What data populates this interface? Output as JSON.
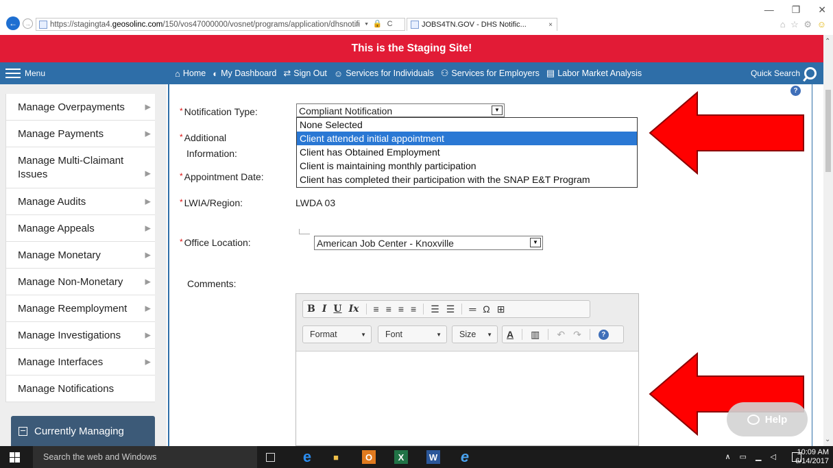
{
  "browser": {
    "url_prefix": "https://stagingta4.",
    "url_domain": "geosolinc.com",
    "url_rest": "/150/vos47000000/vosnet/programs/application/dhsnotifi",
    "url_tools": "⌕ ▾ 🔒 C",
    "tab_title": "JOBS4TN.GOV - DHS Notific...",
    "tab_close": "×",
    "window_controls": [
      "—",
      "❐",
      "✕"
    ],
    "toolbar_icons": "⌂ ☆ ⚙"
  },
  "banner": {
    "text": "This is the Staging Site!"
  },
  "nav": {
    "menu_label": "Menu",
    "links": [
      {
        "icon": "⌂",
        "label": "Home"
      },
      {
        "icon": "◐",
        "label": "My Dashboard"
      },
      {
        "icon": "⇄",
        "label": "Sign Out"
      },
      {
        "icon": "☺",
        "label": "Services for Individuals"
      },
      {
        "icon": "⚇",
        "label": "Services for Employers"
      },
      {
        "icon": "▤",
        "label": "Labor Market Analysis"
      }
    ],
    "quick_search": "Quick Search"
  },
  "sidebar": {
    "items": [
      {
        "label": "Manage Overpayments",
        "chevron": true
      },
      {
        "label": "Manage Payments",
        "chevron": true
      },
      {
        "label": "Manage Multi-Claimant Issues",
        "chevron": true
      },
      {
        "label": "Manage Audits",
        "chevron": true
      },
      {
        "label": "Manage Appeals",
        "chevron": true
      },
      {
        "label": "Manage Monetary",
        "chevron": true
      },
      {
        "label": "Manage Non-Monetary",
        "chevron": true
      },
      {
        "label": "Manage Reemployment",
        "chevron": true
      },
      {
        "label": "Manage Investigations",
        "chevron": true
      },
      {
        "label": "Manage Interfaces",
        "chevron": true
      },
      {
        "label": "Manage Notifications",
        "chevron": false
      }
    ],
    "currently_managing": "Currently Managing"
  },
  "form": {
    "required_mark": "*",
    "notification_type_label": "Notification Type:",
    "notification_type_value": "Compliant Notification",
    "additional_info_label_1": "Additional",
    "additional_info_label_2": "Information:",
    "dropdown_options": [
      "None Selected",
      "Client attended initial appointment",
      "Client has Obtained Employment",
      "Client is maintaining monthly participation",
      "Client has completed their participation with the SNAP E&T Program"
    ],
    "dropdown_selected_index": 1,
    "appointment_date_label": "Appointment Date:",
    "lwia_label": "LWIA/Region:",
    "lwia_value": "LWDA 03",
    "office_location_label": "Office Location:",
    "office_location_value": "American Job Center - Knoxville",
    "comments_label": "Comments:",
    "help_glyph": "?"
  },
  "editor": {
    "row1_buttons": [
      "B",
      "I",
      "U",
      "Ix",
      "≡",
      "≡",
      "≡",
      "≡",
      "☰",
      "☰",
      "═",
      "Ω",
      "⊞"
    ],
    "format_label": "Format",
    "font_label": "Font",
    "size_label": "Size",
    "text_color": "A",
    "row2_icons": [
      "▥",
      "↶",
      "↷"
    ],
    "help": "?"
  },
  "help_widget": {
    "label": "Help"
  },
  "taskbar": {
    "search_placeholder": "Search the web and Windows",
    "apps": [
      "e",
      "■",
      "O",
      "X",
      "W",
      "e"
    ],
    "tray_icons": "∧ ▭ ▁ ◁",
    "time": "10:09 AM",
    "date": "6/14/2017"
  },
  "colors": {
    "banner": "#e21b36",
    "nav": "#2e6ea8",
    "arrow": "#ff0000",
    "selected_option": "#2a78d4"
  }
}
